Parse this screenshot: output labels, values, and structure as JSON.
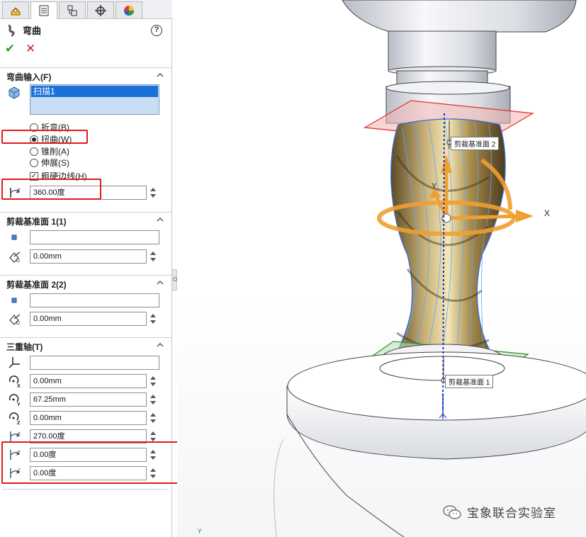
{
  "tabs": [
    {
      "name": "featuremanager",
      "icon": "feature-manager-icon"
    },
    {
      "name": "propertymanager",
      "icon": "property-manager-icon",
      "active": true
    },
    {
      "name": "configurationmanager",
      "icon": "configuration-manager-icon"
    },
    {
      "name": "dimxpert",
      "icon": "dimxpert-icon"
    },
    {
      "name": "display",
      "icon": "display-manager-icon"
    }
  ],
  "header": {
    "title": "弯曲",
    "help": "?"
  },
  "bend_input": {
    "title": "弯曲输入(F)",
    "selected_body": "扫描1",
    "options": [
      "折弯(B)",
      "扭曲(W)",
      "锥削(A)",
      "伸展(S)"
    ],
    "selected_option": "扭曲(W)",
    "hard_edges_label": "粗硬边线(H)",
    "angle_value": "360.00度"
  },
  "trim_plane1": {
    "title": "剪裁基准面 1(1)",
    "reference": "",
    "distance": "0.00mm"
  },
  "trim_plane2": {
    "title": "剪裁基准面 2(2)",
    "reference": "",
    "distance": "0.00mm"
  },
  "triad": {
    "title": "三重轴(T)",
    "reference": "",
    "x": "0.00mm",
    "y": "67.25mm",
    "z": "0.00mm",
    "rot_x": "270.00度",
    "rot_y": "0.00度",
    "rot_z": "0.00度"
  },
  "viewport": {
    "label_plane2": "剪裁基准面 2",
    "label_plane1": "剪裁基准面 1",
    "axis_x": "X",
    "axis_y": "Y",
    "axis_small_y": "Y"
  },
  "watermark": "宝象联合实验室",
  "colors": {
    "accent": "#1c71d8",
    "highlight_box": "#e01a1a",
    "triad_orange": "#f0a030",
    "plane1": "#2e9a2e",
    "plane2": "#e0342c"
  }
}
